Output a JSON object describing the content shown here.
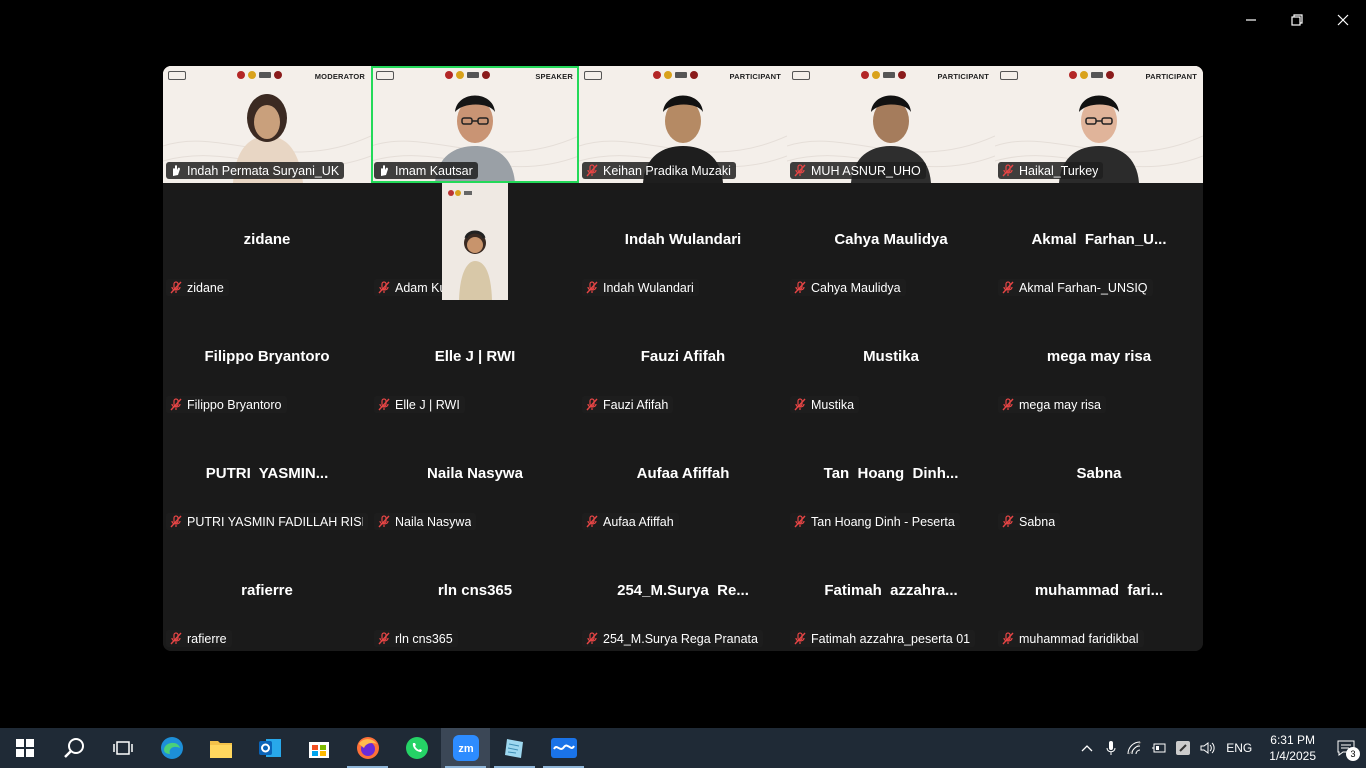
{
  "window": {
    "controls": [
      "minimize",
      "restore",
      "close"
    ]
  },
  "video_tiles": [
    {
      "role": "MODERATOR",
      "name": "Indah Permata Suryani_UK",
      "mic": "raised-hand",
      "active": false
    },
    {
      "role": "SPEAKER",
      "name": "Imam Kautsar",
      "mic": "raised-hand",
      "active": true
    },
    {
      "role": "PARTICIPANT",
      "name": "Keihan Pradika Muzaki",
      "mic": "muted",
      "active": false
    },
    {
      "role": "PARTICIPANT",
      "name": "MUH ASNUR_UHO",
      "mic": "muted",
      "active": false
    },
    {
      "role": "PARTICIPANT",
      "name": "Haikal_Turkey",
      "mic": "muted",
      "active": false
    }
  ],
  "name_tiles": [
    {
      "display": "zidane",
      "label": "zidane"
    },
    {
      "display": "",
      "label": "Adam Kusuma"
    },
    {
      "display": "Indah Wulandari",
      "label": "Indah Wulandari"
    },
    {
      "display": "Cahya Maulidya",
      "label": "Cahya Maulidya"
    },
    {
      "display": "Akmal  Farhan_U...",
      "label": "Akmal Farhan-_UNSIQ"
    },
    {
      "display": "Filippo Bryantoro",
      "label": "Filippo Bryantoro"
    },
    {
      "display": "Elle J | RWI",
      "label": "Elle J | RWI"
    },
    {
      "display": "Fauzi Afifah",
      "label": "Fauzi Afifah"
    },
    {
      "display": "Mustika",
      "label": "Mustika"
    },
    {
      "display": "mega may risa",
      "label": "mega may risa"
    },
    {
      "display": "PUTRI  YASMIN...",
      "label": "PUTRI YASMIN FADILLAH RISK..."
    },
    {
      "display": "Naila Nasywa",
      "label": "Naila Nasywa"
    },
    {
      "display": "Aufaa Afiffah",
      "label": "Aufaa Afiffah"
    },
    {
      "display": "Tan  Hoang  Dinh...",
      "label": "Tan Hoang Dinh - Peserta"
    },
    {
      "display": "Sabna",
      "label": "Sabna"
    },
    {
      "display": "rafierre",
      "label": "rafierre"
    },
    {
      "display": "rln cns365",
      "label": "rln cns365"
    },
    {
      "display": "254_M.Surya  Re...",
      "label": "254_M.Surya Rega Pranata"
    },
    {
      "display": "Fatimah  azzahra...",
      "label": "Fatimah azzahra_peserta 01"
    },
    {
      "display": "muhammad  fari...",
      "label": "muhammad faridikbal"
    }
  ],
  "taskbar": {
    "apps": [
      {
        "icon": "windows-start-icon",
        "running": false
      },
      {
        "icon": "search-icon",
        "running": false
      },
      {
        "icon": "task-view-icon",
        "running": false
      },
      {
        "icon": "edge-icon",
        "running": false
      },
      {
        "icon": "file-explorer-icon",
        "running": false
      },
      {
        "icon": "outlook-icon",
        "running": false
      },
      {
        "icon": "microsoft-store-icon",
        "running": false
      },
      {
        "icon": "firefox-icon",
        "running": true
      },
      {
        "icon": "whatsapp-icon",
        "running": false
      },
      {
        "icon": "zoom-icon",
        "running": true,
        "label": "zm"
      },
      {
        "icon": "notes-icon",
        "running": true
      },
      {
        "icon": "wave-app-icon",
        "running": true
      }
    ],
    "tray": {
      "language": "ENG",
      "time": "6:31 PM",
      "date": "1/4/2025",
      "notifications": "3"
    }
  },
  "colors": {
    "active_border": "#23d959",
    "taskbar": "#1f2a36",
    "tile_bg": "#1a1a1a"
  }
}
